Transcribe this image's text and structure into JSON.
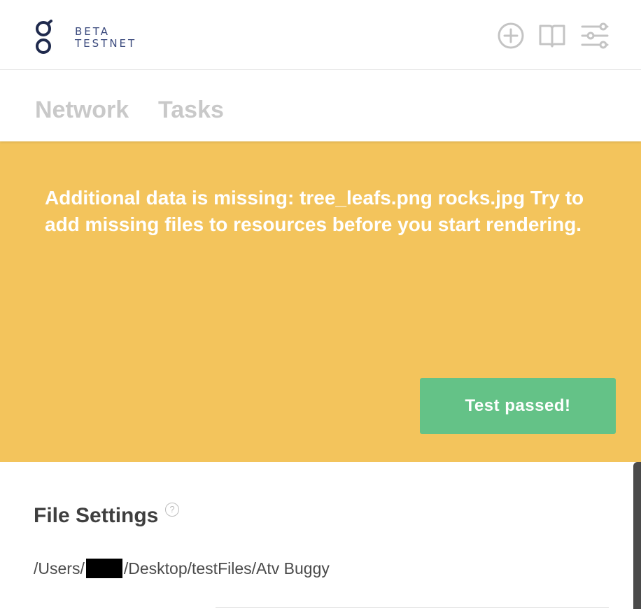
{
  "header": {
    "brand_line1": "BETA",
    "brand_line2": "TESTNET",
    "icons": [
      "plus-circle-icon",
      "book-icon",
      "sliders-icon"
    ],
    "brand_color": "#3b4a7d"
  },
  "tabs": [
    {
      "label": "Network"
    },
    {
      "label": "Tasks"
    }
  ],
  "banner": {
    "message": "Additional data is missing: tree_leafs.png rocks.jpg Try to add missing files to resources before you start rendering.",
    "background": "#f3c45c",
    "button_label": "Test passed!",
    "button_color": "#64c287"
  },
  "file_settings": {
    "title": "File Settings",
    "help_symbol": "?",
    "path_prefix": "/Users/",
    "path_suffix": "/Desktop/testFiles/Atv Buggy"
  }
}
